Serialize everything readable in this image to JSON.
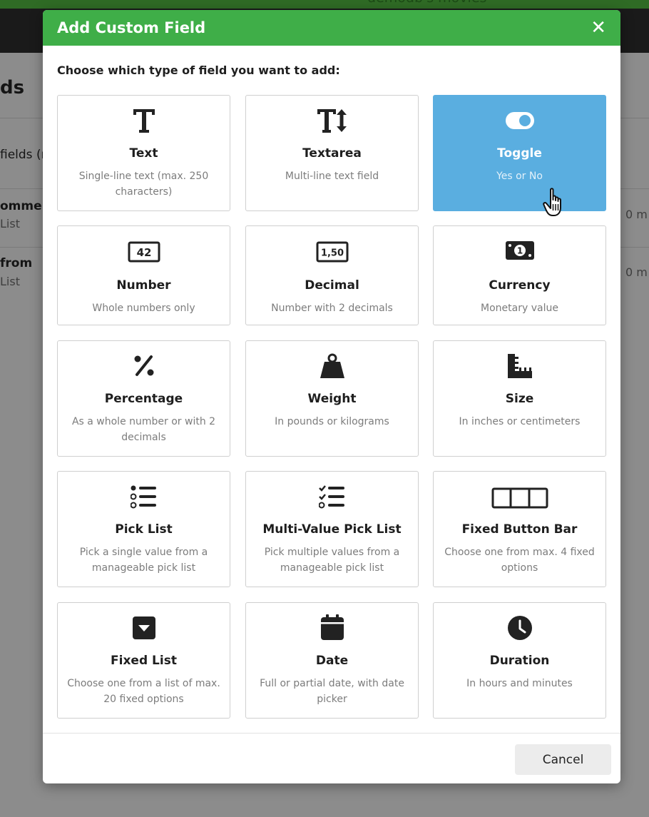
{
  "background": {
    "top_title": "demodb's movies",
    "heading": "ds",
    "fields_label": "fields (r",
    "rows": [
      {
        "title": "ommen",
        "sub": "List",
        "right": "0 m"
      },
      {
        "title": "from",
        "sub": "List",
        "right": "0 m"
      }
    ]
  },
  "modal": {
    "title": "Add Custom Field",
    "close_symbol": "✕",
    "prompt": "Choose which type of field you want to add:",
    "cancel_label": "Cancel",
    "selected": "Toggle",
    "field_types": [
      {
        "icon": "text-icon",
        "title": "Text",
        "description": "Single-line text (max. 250 characters)"
      },
      {
        "icon": "textarea-icon",
        "title": "Textarea",
        "description": "Multi-line text field"
      },
      {
        "icon": "toggle-icon",
        "title": "Toggle",
        "description": "Yes or No"
      },
      {
        "icon": "number-icon",
        "icon_text": "42",
        "title": "Number",
        "description": "Whole numbers only"
      },
      {
        "icon": "decimal-icon",
        "icon_text": "1,50",
        "title": "Decimal",
        "description": "Number with 2 decimals"
      },
      {
        "icon": "currency-icon",
        "title": "Currency",
        "description": "Monetary value"
      },
      {
        "icon": "percent-icon",
        "title": "Percentage",
        "description": "As a whole number or with 2 decimals"
      },
      {
        "icon": "weight-icon",
        "title": "Weight",
        "description": "In pounds or kilograms"
      },
      {
        "icon": "ruler-icon",
        "title": "Size",
        "description": "In inches or centimeters"
      },
      {
        "icon": "list-icon",
        "title": "Pick List",
        "description": "Pick a single value from a manageable pick list"
      },
      {
        "icon": "checklist-icon",
        "title": "Multi-Value Pick List",
        "description": "Pick multiple values from a manageable pick list"
      },
      {
        "icon": "button-bar-icon",
        "title": "Fixed Button Bar",
        "description": "Choose one from max. 4 fixed options"
      },
      {
        "icon": "dropdown-icon",
        "title": "Fixed List",
        "description": "Choose one from a list of max. 20 fixed options"
      },
      {
        "icon": "calendar-icon",
        "title": "Date",
        "description": "Full or partial date, with date picker"
      },
      {
        "icon": "clock-icon",
        "title": "Duration",
        "description": "In hours and minutes"
      }
    ]
  },
  "colors": {
    "header_green": "#3fae48",
    "selected_blue": "#5aaee0",
    "overlay_gray": "#8a8a8a"
  }
}
